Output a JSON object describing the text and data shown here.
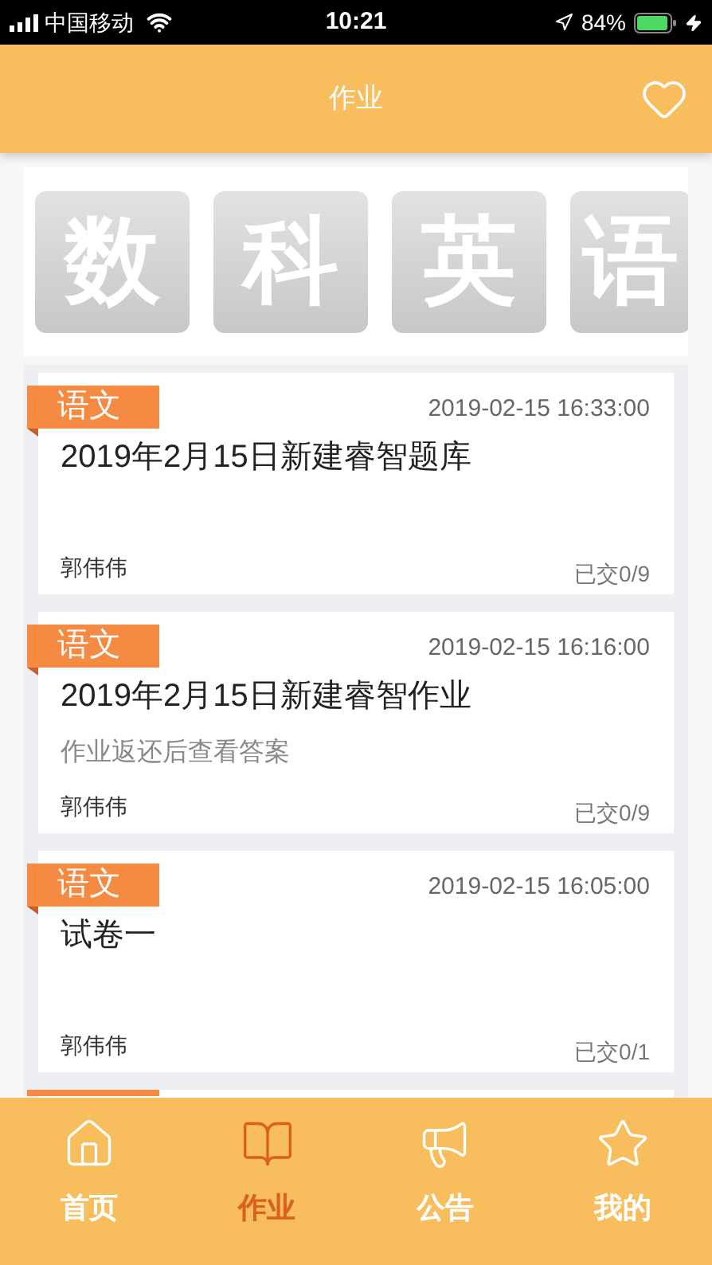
{
  "status_bar": {
    "carrier": "中国移动",
    "time": "10:21",
    "battery": "84%"
  },
  "header": {
    "title": "作业"
  },
  "subjects": [
    "数",
    "科",
    "英",
    "语"
  ],
  "assignments": [
    {
      "subject": "语文",
      "date": "2019-02-15 16:33:00",
      "title": "2019年2月15日新建睿智题库",
      "author": "郭伟伟",
      "submitted": "已交0/9"
    },
    {
      "subject": "语文",
      "date": "2019-02-15 16:16:00",
      "title": "2019年2月15日新建睿智作业",
      "note": "作业返还后查看答案",
      "author": "郭伟伟",
      "submitted": "已交0/9"
    },
    {
      "subject": "语文",
      "date": "2019-02-15 16:05:00",
      "title": "试卷一",
      "author": "郭伟伟",
      "submitted": "已交0/1"
    }
  ],
  "tabs": [
    {
      "label": "首页",
      "selected": false
    },
    {
      "label": "作业",
      "selected": true
    },
    {
      "label": "公告",
      "selected": false
    },
    {
      "label": "我的",
      "selected": false
    }
  ]
}
